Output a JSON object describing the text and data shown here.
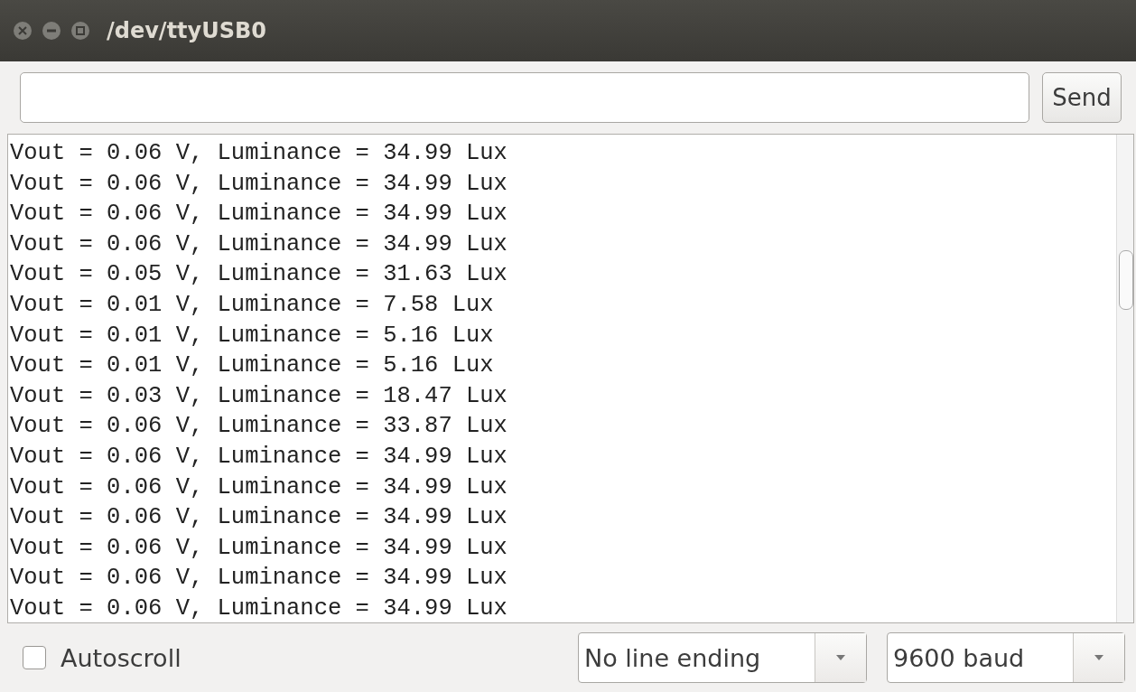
{
  "window": {
    "title": "/dev/ttyUSB0"
  },
  "send_button": "Send",
  "output_lines": [
    "Vout = 0.06 V, Luminance = 34.99 Lux",
    "Vout = 0.06 V, Luminance = 34.99 Lux",
    "Vout = 0.06 V, Luminance = 34.99 Lux",
    "Vout = 0.06 V, Luminance = 34.99 Lux",
    "Vout = 0.05 V, Luminance = 31.63 Lux",
    "Vout = 0.01 V, Luminance = 7.58 Lux",
    "Vout = 0.01 V, Luminance = 5.16 Lux",
    "Vout = 0.01 V, Luminance = 5.16 Lux",
    "Vout = 0.03 V, Luminance = 18.47 Lux",
    "Vout = 0.06 V, Luminance = 33.87 Lux",
    "Vout = 0.06 V, Luminance = 34.99 Lux",
    "Vout = 0.06 V, Luminance = 34.99 Lux",
    "Vout = 0.06 V, Luminance = 34.99 Lux",
    "Vout = 0.06 V, Luminance = 34.99 Lux",
    "Vout = 0.06 V, Luminance = 34.99 Lux",
    "Vout = 0.06 V, Luminance = 34.99 Lux"
  ],
  "autoscroll": {
    "label": "Autoscroll",
    "checked": false
  },
  "line_ending": {
    "value": "No line ending"
  },
  "baud_rate": {
    "value": "9600 baud"
  }
}
